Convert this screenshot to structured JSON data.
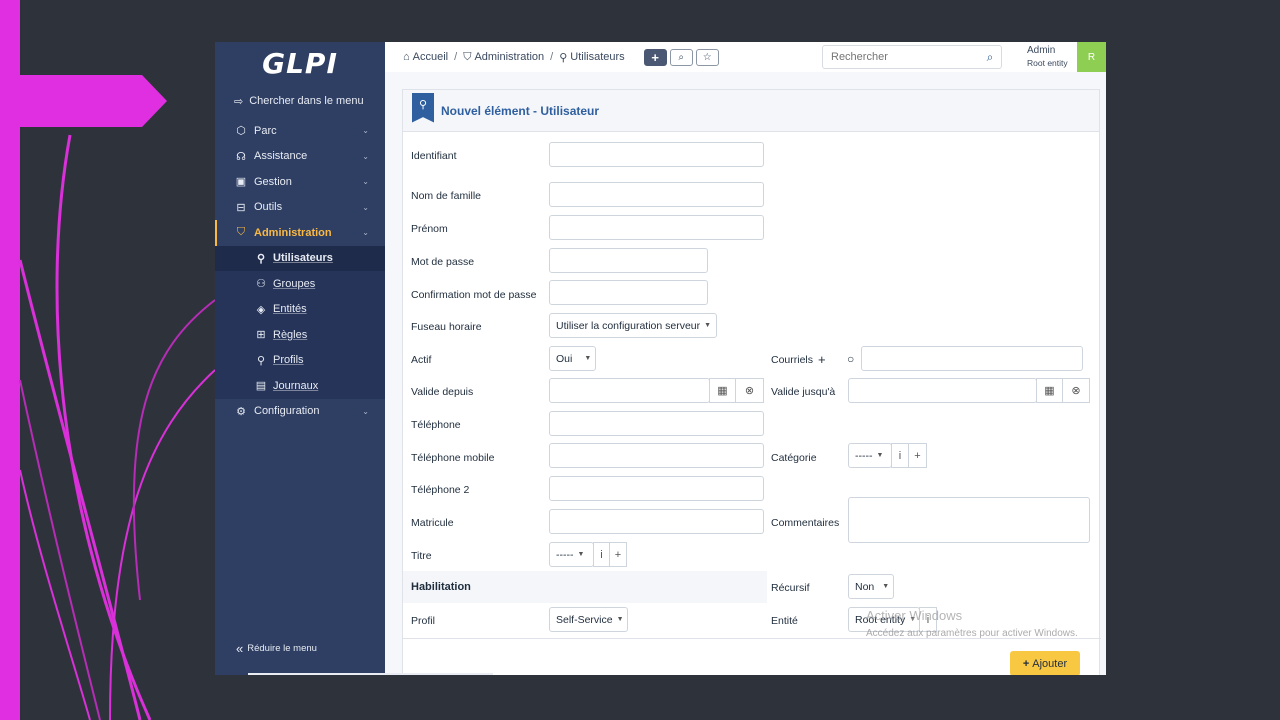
{
  "sidebar": {
    "logo": "GLPI",
    "search_label": "Chercher dans le menu",
    "items": [
      {
        "label": "Parc"
      },
      {
        "label": "Assistance"
      },
      {
        "label": "Gestion"
      },
      {
        "label": "Outils"
      },
      {
        "label": "Administration"
      }
    ],
    "sub_items": [
      {
        "label": "Utilisateurs"
      },
      {
        "label": "Groupes"
      },
      {
        "label": "Entités"
      },
      {
        "label": "Règles"
      },
      {
        "label": "Profils"
      },
      {
        "label": "Journaux"
      }
    ],
    "config_label": "Configuration",
    "collapse_label": "Réduire le menu"
  },
  "breadcrumb": {
    "home": "Accueil",
    "admin": "Administration",
    "users": "Utilisateurs"
  },
  "search": {
    "placeholder": "Rechercher"
  },
  "user": {
    "name": "Admin",
    "entity": "Root entity",
    "initial": "R"
  },
  "form": {
    "title": "Nouvel élément - Utilisateur",
    "labels": {
      "identifiant": "Identifiant",
      "nom": "Nom de famille",
      "prenom": "Prénom",
      "mdp": "Mot de passe",
      "confirm": "Confirmation mot de passe",
      "fuseau": "Fuseau horaire",
      "actif": "Actif",
      "courriels": "Courriels",
      "valide_depuis": "Valide depuis",
      "valide_jusqua": "Valide jusqu'à",
      "tel": "Téléphone",
      "tel_mobile": "Téléphone mobile",
      "categorie": "Catégorie",
      "tel2": "Téléphone 2",
      "matricule": "Matricule",
      "commentaires": "Commentaires",
      "titre": "Titre",
      "habilitation": "Habilitation",
      "recursif": "Récursif",
      "profil": "Profil",
      "entite": "Entité"
    },
    "values": {
      "fuseau": "Utiliser la configuration serveur",
      "actif": "Oui",
      "categorie": "-----",
      "titre": "-----",
      "recursif": "Non",
      "profil": "Self-Service",
      "entite": "Root entity"
    },
    "submit": "Ajouter"
  },
  "watermark": {
    "title": "Activer Windows",
    "subtitle": "Accédez aux paramètres pour activer Windows."
  }
}
